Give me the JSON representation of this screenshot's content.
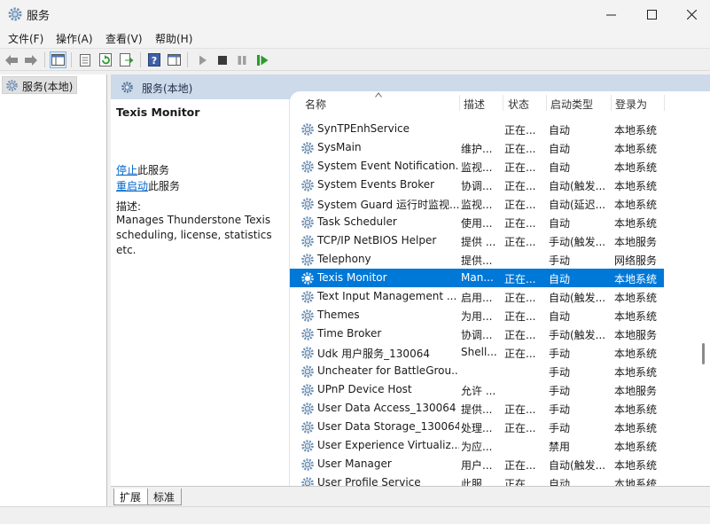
{
  "window": {
    "title": "服务",
    "icon": "gear-icon"
  },
  "menu": [
    "文件(F)",
    "操作(A)",
    "查看(V)",
    "帮助(H)"
  ],
  "toolbar": {
    "icons": [
      "back-arrow-icon",
      "forward-arrow-icon",
      "show-console-tree-icon",
      "properties-icon",
      "refresh-icon",
      "export-list-icon",
      "help-icon",
      "show-action-pane-icon",
      "start-service-icon",
      "stop-service-icon",
      "pause-service-icon",
      "restart-service-icon"
    ]
  },
  "tree": {
    "item": "服务(本地)"
  },
  "header": {
    "title": "服务(本地)"
  },
  "description_pane": {
    "service_name": "Texis Monitor",
    "stop_link": "停止",
    "stop_suffix": "此服务",
    "restart_link": "重启动",
    "restart_suffix": "此服务",
    "desc_label": "描述:",
    "desc_text": "Manages Thunderstone Texis scheduling, license, statistics etc."
  },
  "columns": [
    "名称",
    "描述",
    "状态",
    "启动类型",
    "登录为"
  ],
  "rows": [
    {
      "name": "SynTPEnhService",
      "desc": "",
      "status": "正在...",
      "startup": "自动",
      "logon": "本地系统"
    },
    {
      "name": "SysMain",
      "desc": "维护...",
      "status": "正在...",
      "startup": "自动",
      "logon": "本地系统"
    },
    {
      "name": "System Event Notification...",
      "desc": "监视...",
      "status": "正在...",
      "startup": "自动",
      "logon": "本地系统"
    },
    {
      "name": "System Events Broker",
      "desc": "协调...",
      "status": "正在...",
      "startup": "自动(触发...",
      "logon": "本地系统"
    },
    {
      "name": "System Guard 运行时监视...",
      "desc": "监视...",
      "status": "正在...",
      "startup": "自动(延迟...",
      "logon": "本地系统"
    },
    {
      "name": "Task Scheduler",
      "desc": "使用...",
      "status": "正在...",
      "startup": "自动",
      "logon": "本地系统"
    },
    {
      "name": "TCP/IP NetBIOS Helper",
      "desc": "提供 ...",
      "status": "正在...",
      "startup": "手动(触发...",
      "logon": "本地服务"
    },
    {
      "name": "Telephony",
      "desc": "提供...",
      "status": "",
      "startup": "手动",
      "logon": "网络服务"
    },
    {
      "name": "Texis Monitor",
      "desc": "Man...",
      "status": "正在...",
      "startup": "自动",
      "logon": "本地系统",
      "selected": true
    },
    {
      "name": "Text Input Management ...",
      "desc": "启用...",
      "status": "正在...",
      "startup": "自动(触发...",
      "logon": "本地系统"
    },
    {
      "name": "Themes",
      "desc": "为用...",
      "status": "正在...",
      "startup": "自动",
      "logon": "本地系统"
    },
    {
      "name": "Time Broker",
      "desc": "协调...",
      "status": "正在...",
      "startup": "手动(触发...",
      "logon": "本地服务"
    },
    {
      "name": "Udk 用户服务_130064",
      "desc": "Shell...",
      "status": "正在...",
      "startup": "手动",
      "logon": "本地系统"
    },
    {
      "name": "Uncheater for BattleGrou...",
      "desc": "",
      "status": "",
      "startup": "手动",
      "logon": "本地系统"
    },
    {
      "name": "UPnP Device Host",
      "desc": "允许 ...",
      "status": "",
      "startup": "手动",
      "logon": "本地服务"
    },
    {
      "name": "User Data Access_130064",
      "desc": "提供...",
      "status": "正在...",
      "startup": "手动",
      "logon": "本地系统"
    },
    {
      "name": "User Data Storage_130064",
      "desc": "处理...",
      "status": "正在...",
      "startup": "手动",
      "logon": "本地系统"
    },
    {
      "name": "User Experience Virtualiz...",
      "desc": "为应...",
      "status": "",
      "startup": "禁用",
      "logon": "本地系统"
    },
    {
      "name": "User Manager",
      "desc": "用户...",
      "status": "正在...",
      "startup": "自动(触发...",
      "logon": "本地系统"
    },
    {
      "name": "User Profile Service",
      "desc": "此服...",
      "status": "正在...",
      "startup": "自动",
      "logon": "本地系统"
    }
  ],
  "tabs": [
    "扩展",
    "标准"
  ],
  "colors": {
    "header_bg": "#ccdaea",
    "selection": "#0078d7",
    "link": "#0066cc"
  }
}
